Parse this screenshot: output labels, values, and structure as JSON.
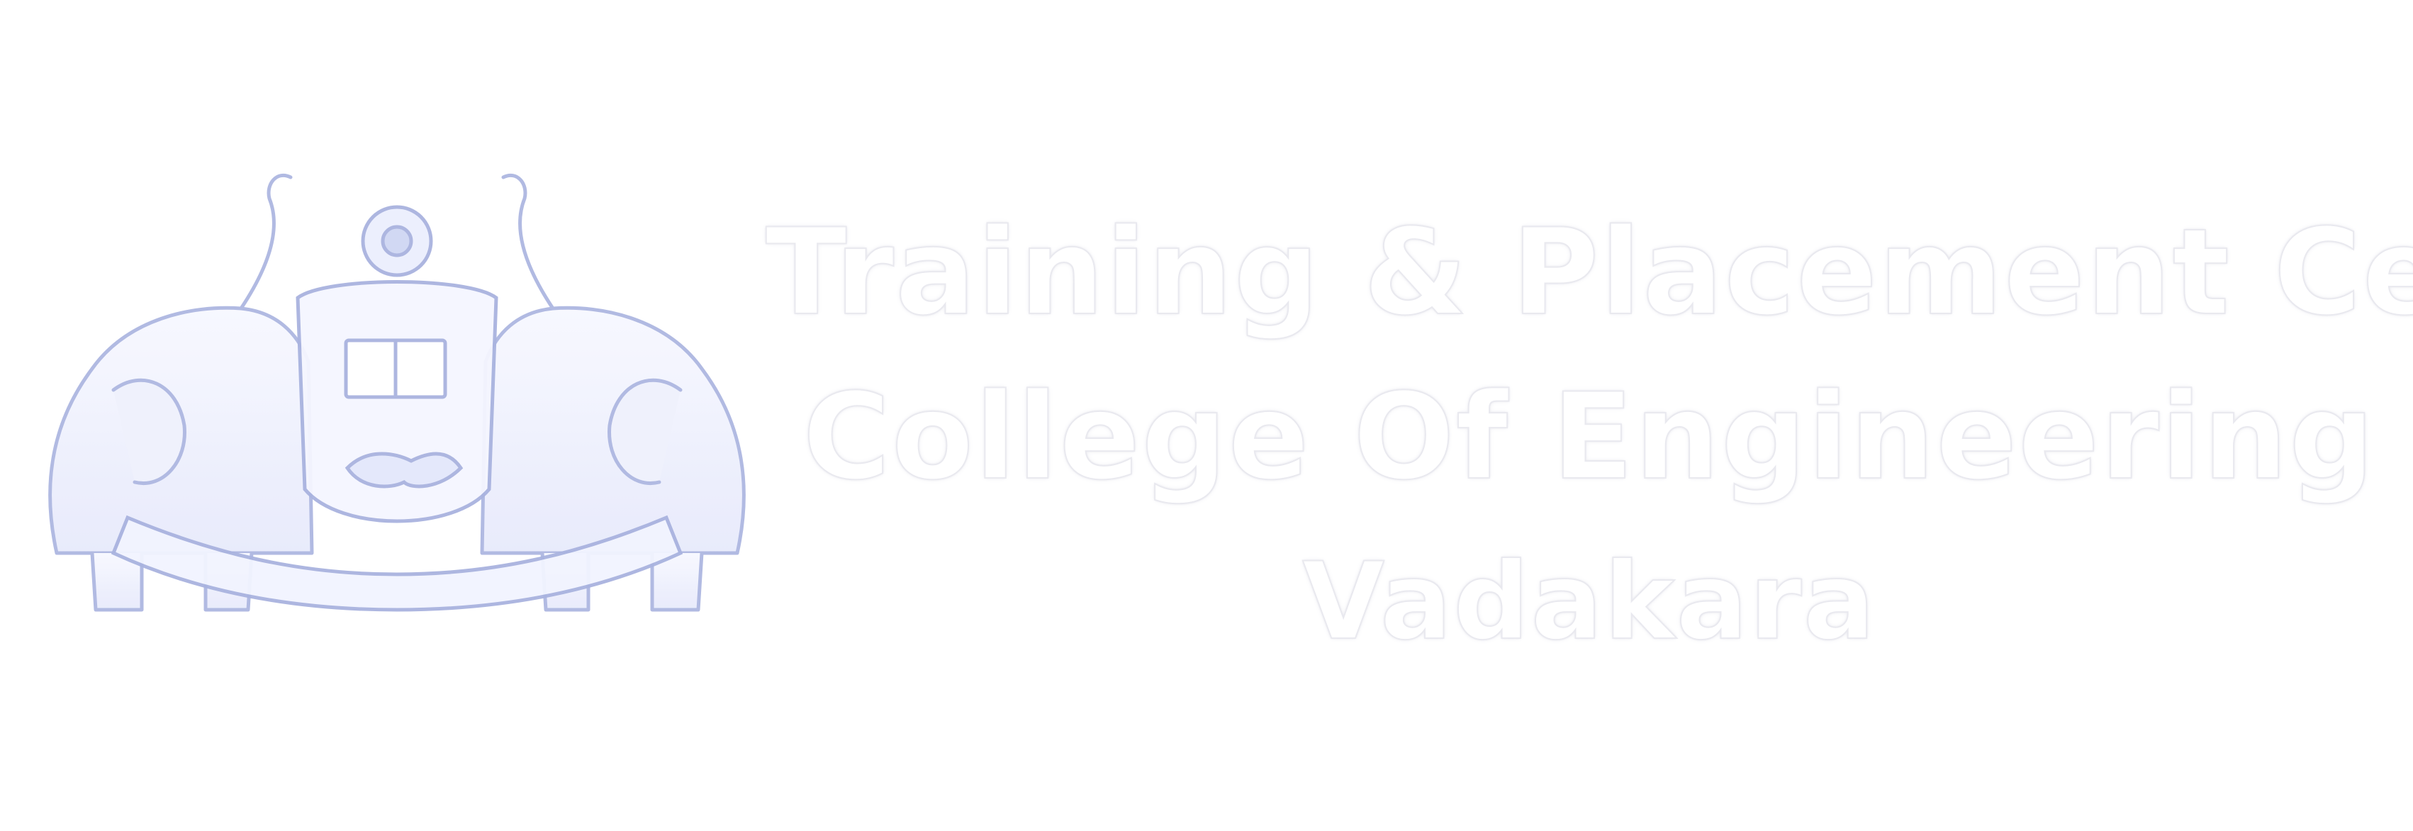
{
  "header": {
    "line1": "Training & Placement Cell",
    "line2": "College Of Engineering",
    "line3": "Vadakara"
  },
  "emblem": {
    "icon": "state-emblem-elephants-icon",
    "colors": {
      "line": "#9aa6d8",
      "shade": "#c9d1f0",
      "fill": "#f4f6ff"
    }
  }
}
